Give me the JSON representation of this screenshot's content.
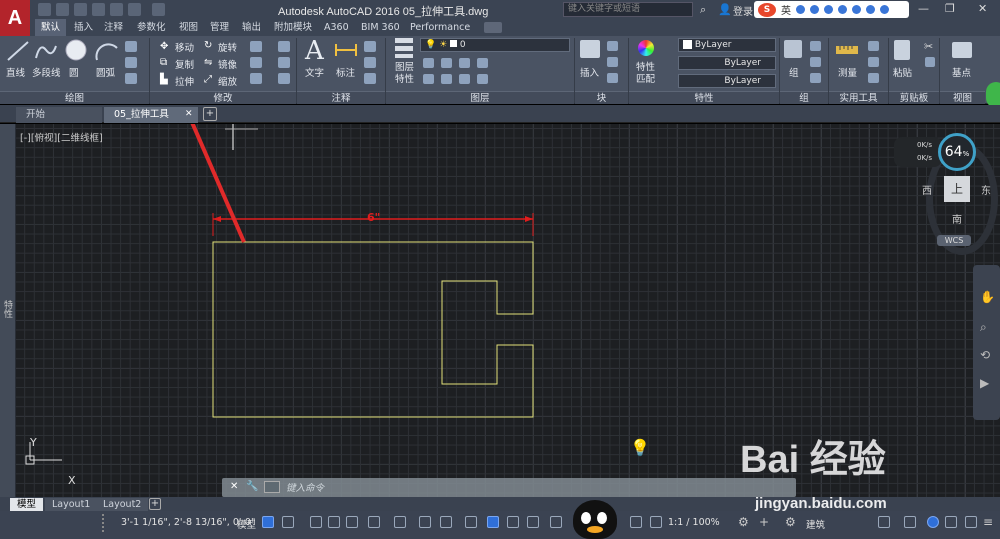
{
  "app": {
    "logo": "A",
    "title": "Autodesk AutoCAD 2016    05_拉伸工具.dwg",
    "search_placeholder": "键入关键字或短语",
    "login": "登录",
    "ime": "英"
  },
  "ribbon_tabs": [
    "默认",
    "插入",
    "注释",
    "参数化",
    "视图",
    "管理",
    "输出",
    "附加模块",
    "A360",
    "BIM 360",
    "Performance"
  ],
  "draw_panel": {
    "name": "绘图",
    "tools": [
      "直线",
      "多段线",
      "圆",
      "圆弧"
    ]
  },
  "modify_panel": {
    "name": "修改",
    "move": "移动",
    "copy": "复制",
    "stretch": "拉伸",
    "rotate": "旋转",
    "mirror": "镜像",
    "scale": "缩放"
  },
  "annotation_panel": {
    "name": "注释",
    "text": "文字",
    "dimension": "标注"
  },
  "layers_panel": {
    "name": "图层",
    "properties": "图层\n特性",
    "current_layer": "0"
  },
  "block_panel": {
    "name": "块",
    "insert": "插入"
  },
  "properties_panel": {
    "name": "特性",
    "match": "特性\n匹配",
    "color": "ByLayer",
    "linetype": "ByLayer",
    "lineweight": "ByLayer"
  },
  "groups_panel": {
    "name": "组",
    "group": "组"
  },
  "utilities_panel": {
    "name": "实用工具",
    "measure": "测量"
  },
  "clipboard_panel": {
    "name": "剪贴板",
    "paste": "粘贴"
  },
  "view_panel": {
    "name": "视图",
    "base": "基点"
  },
  "doc_tabs": [
    "开始",
    "05_拉伸工具"
  ],
  "viewport": {
    "label": "[-][俯视][二维线框]",
    "dimension": "6\""
  },
  "viewcube": {
    "top": "上",
    "west": "西",
    "east": "东",
    "south": "南",
    "wcs": "WCS",
    "percent": "64",
    "up_rate": "0K/s",
    "down_rate": "0K/s"
  },
  "left_palette": "特性",
  "ucs": {
    "x": "X",
    "y": "Y"
  },
  "command_line": {
    "placeholder": "键入命令"
  },
  "layout_tabs": [
    "模型",
    "Layout1",
    "Layout2"
  ],
  "status": {
    "coords": "3'-1 1/16\", 2'-8 13/16\", 0'-0\"",
    "model": "模型",
    "scale": "1:1 / 100%",
    "workspace": "建筑"
  },
  "watermark": {
    "brand": "Bai 经验",
    "site": "jingyan.baidu.com"
  },
  "colors": {
    "drawing_yellow": "#e2e27a",
    "dimension_red": "#e01d1d",
    "ribbon_bg": "#4a5363",
    "logo_red": "#b3242b"
  }
}
